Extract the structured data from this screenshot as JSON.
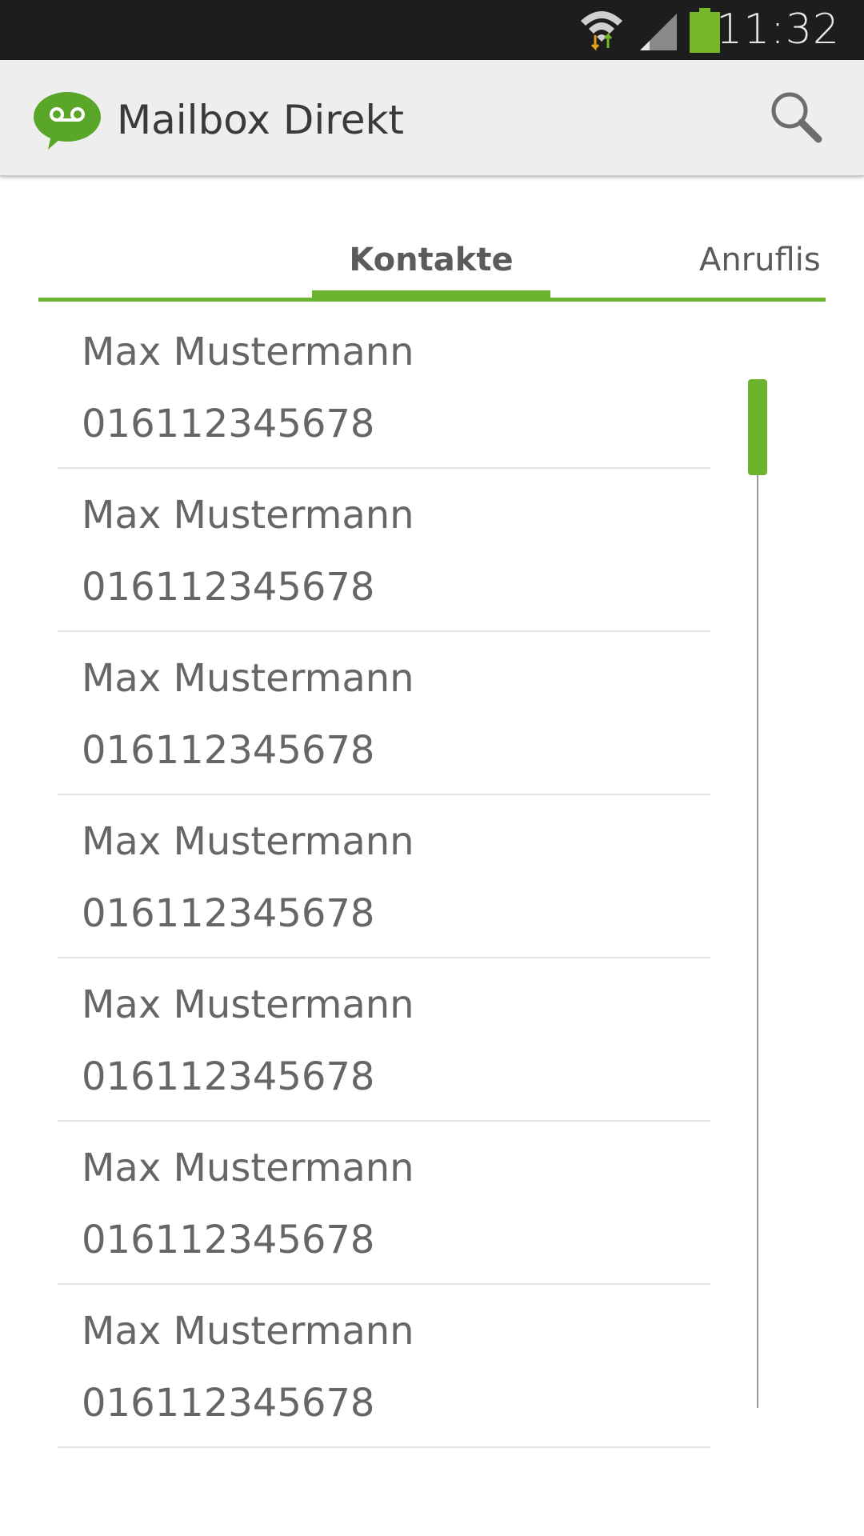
{
  "status_bar": {
    "time": "11:32",
    "icons": [
      "wifi-icon",
      "cell-signal-icon",
      "battery-icon"
    ],
    "battery_color": "#76b82a"
  },
  "action_bar": {
    "app_icon": "voicemail-bubble-icon",
    "title": "Mailbox Direkt",
    "search_icon": "search-icon"
  },
  "tabs": {
    "items": [
      {
        "label": "Kontakte",
        "active": true
      },
      {
        "label": "Anruflis",
        "active": false
      }
    ]
  },
  "colors": {
    "accent": "#6cb42d",
    "text": "#666666",
    "status_bar_bg": "#1d1d1d",
    "action_bar_bg": "#eeeeee"
  },
  "contacts": [
    {
      "name": "Max Mustermann",
      "number": "016112345678"
    },
    {
      "name": "Max Mustermann",
      "number": "016112345678"
    },
    {
      "name": "Max Mustermann",
      "number": "016112345678"
    },
    {
      "name": "Max Mustermann",
      "number": "016112345678"
    },
    {
      "name": "Max Mustermann",
      "number": "016112345678"
    },
    {
      "name": "Max Mustermann",
      "number": "016112345678"
    },
    {
      "name": "Max Mustermann",
      "number": "016112345678"
    }
  ]
}
